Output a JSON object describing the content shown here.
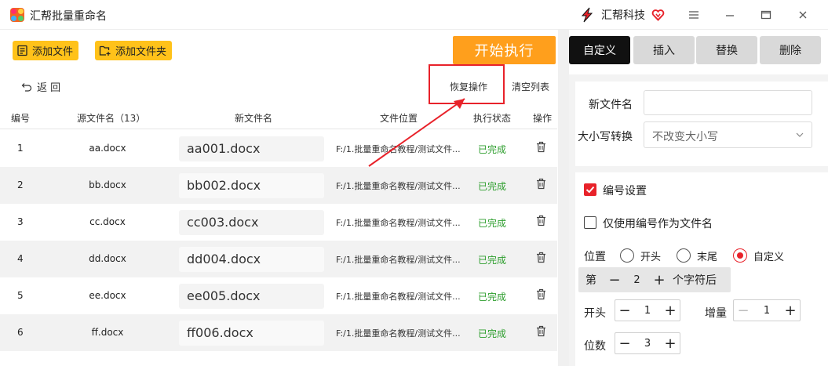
{
  "app": {
    "title": "汇帮批量重命名",
    "brand_name": "汇帮科技"
  },
  "toolbar": {
    "add_file": "添加文件",
    "add_folder": "添加文件夹",
    "start": "开始执行",
    "back": "返 回",
    "restore": "恢复操作",
    "clear": "清空列表"
  },
  "table": {
    "headers": {
      "num": "编号",
      "src": "源文件名（13）",
      "new": "新文件名",
      "loc": "文件位置",
      "status": "执行状态",
      "op": "操作"
    },
    "rows": [
      {
        "num": "1",
        "src": "aa.docx",
        "new": "aa001.docx",
        "loc": "F:/1.批量重命名教程/测试文件...",
        "status": "已完成"
      },
      {
        "num": "2",
        "src": "bb.docx",
        "new": "bb002.docx",
        "loc": "F:/1.批量重命名教程/测试文件...",
        "status": "已完成"
      },
      {
        "num": "3",
        "src": "cc.docx",
        "new": "cc003.docx",
        "loc": "F:/1.批量重命名教程/测试文件...",
        "status": "已完成"
      },
      {
        "num": "4",
        "src": "dd.docx",
        "new": "dd004.docx",
        "loc": "F:/1.批量重命名教程/测试文件...",
        "status": "已完成"
      },
      {
        "num": "5",
        "src": "ee.docx",
        "new": "ee005.docx",
        "loc": "F:/1.批量重命名教程/测试文件...",
        "status": "已完成"
      },
      {
        "num": "6",
        "src": "ff.docx",
        "new": "ff006.docx",
        "loc": "F:/1.批量重命名教程/测试文件...",
        "status": "已完成"
      }
    ]
  },
  "tabs": {
    "custom": "自定义",
    "insert": "插入",
    "replace": "替换",
    "delete": "删除"
  },
  "panel": {
    "new_name_label": "新文件名",
    "new_name_value": "",
    "case_label": "大小写转换",
    "case_value": "不改变大小写",
    "numbering_label": "编号设置",
    "numbering_checked": true,
    "only_number_label": "仅使用编号作为文件名",
    "only_number_checked": false,
    "position_label": "位置",
    "pos_start": "开头",
    "pos_end": "末尾",
    "pos_custom": "自定义",
    "pos_selected": "自定义",
    "custom_prefix": "第",
    "custom_value": "2",
    "custom_suffix": "个字符后",
    "start_label": "开头",
    "start_value": "1",
    "increment_label": "增量",
    "increment_value": "1",
    "digits_label": "位数",
    "digits_value": "3"
  },
  "colors": {
    "accent": "#ffc21a",
    "start": "#ff9f1c",
    "highlight": "#e8222a",
    "done": "#2e9e2e",
    "checkbox": "#e8222a"
  }
}
